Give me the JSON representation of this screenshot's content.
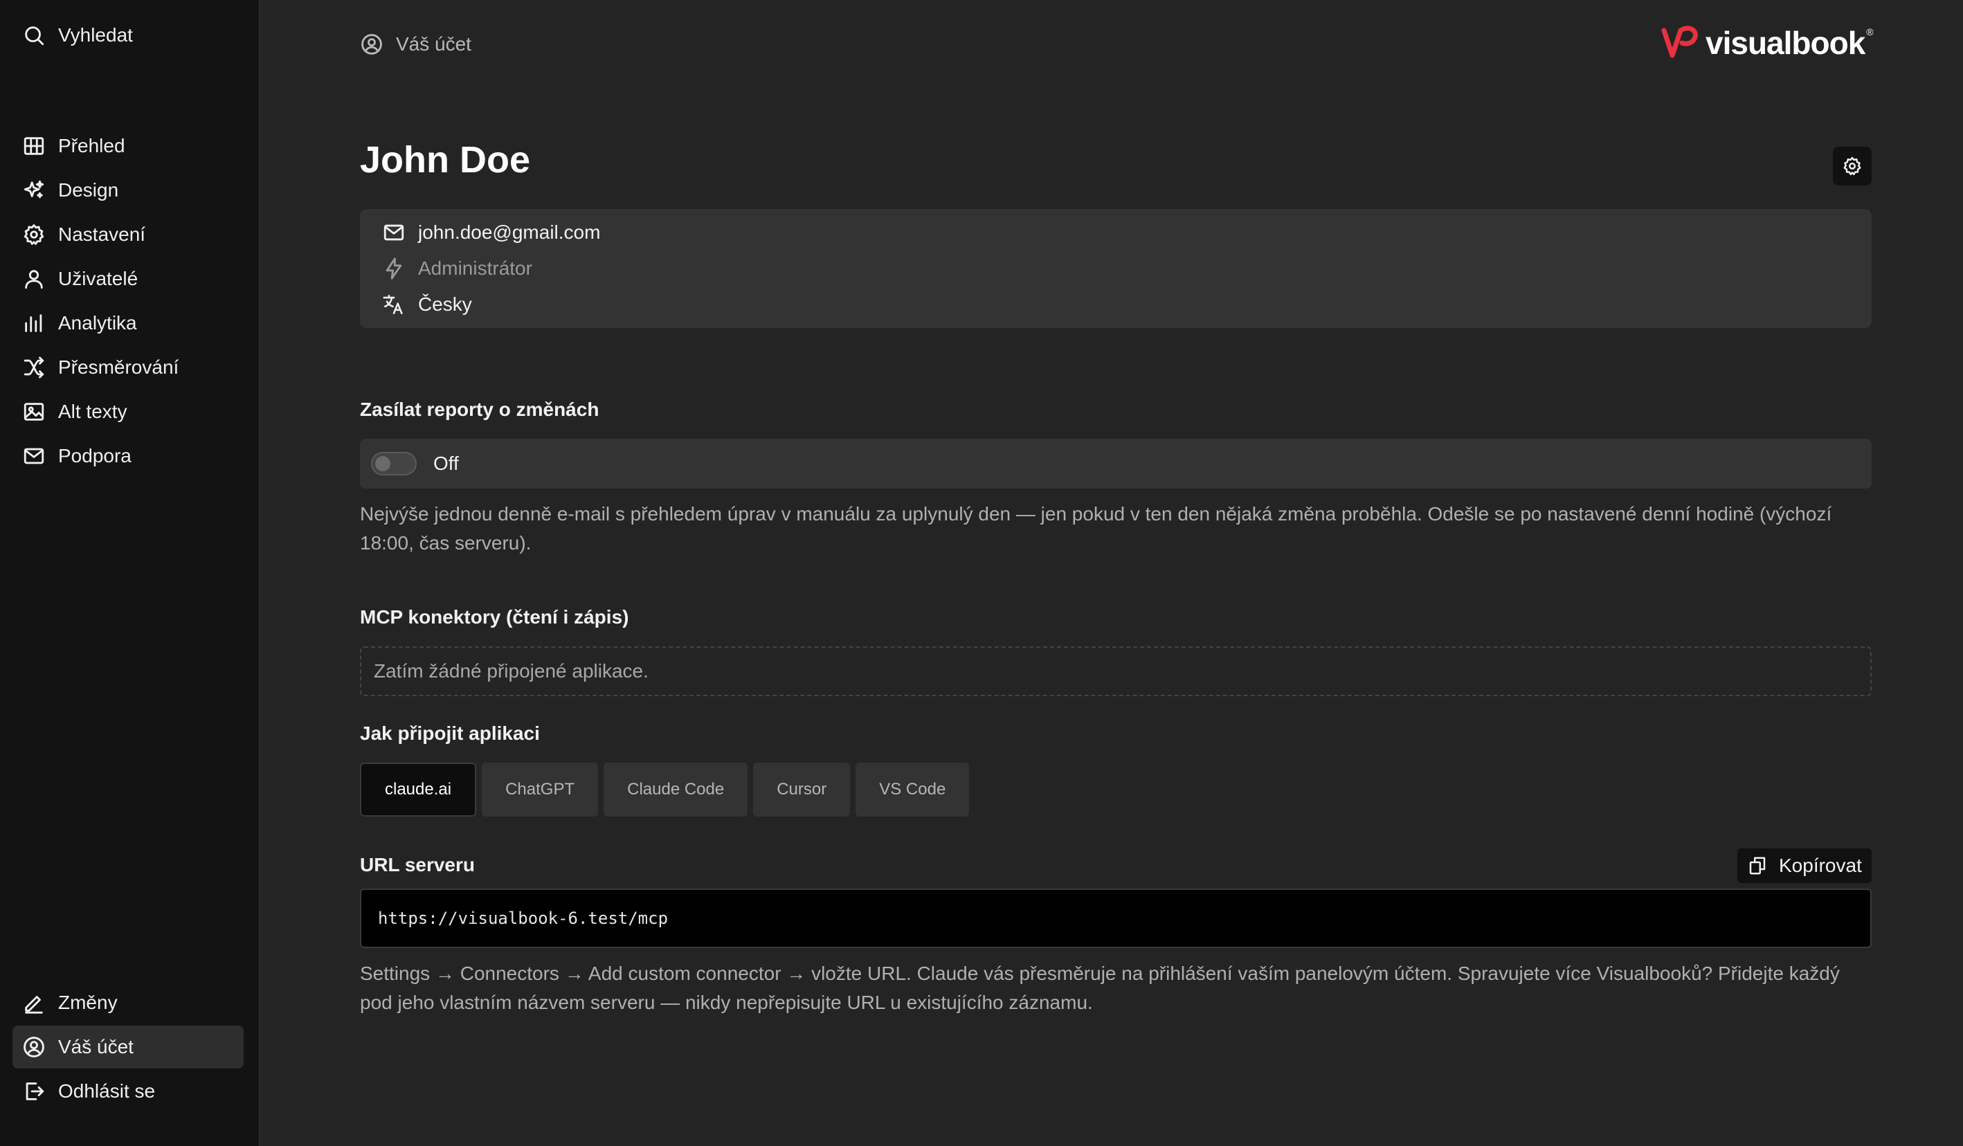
{
  "sidebar": {
    "search": {
      "label": "Vyhledat",
      "icon": "search-icon"
    },
    "items": [
      {
        "label": "Přehled",
        "icon": "grid-icon"
      },
      {
        "label": "Design",
        "icon": "sparkles-icon"
      },
      {
        "label": "Nastavení",
        "icon": "gear-icon"
      },
      {
        "label": "Uživatelé",
        "icon": "user-icon"
      },
      {
        "label": "Analytika",
        "icon": "bar-chart-icon"
      },
      {
        "label": "Přesměrování",
        "icon": "shuffle-icon"
      },
      {
        "label": "Alt texty",
        "icon": "image-icon"
      },
      {
        "label": "Podpora",
        "icon": "mail-icon"
      }
    ],
    "bottom": [
      {
        "label": "Změny",
        "icon": "pencil-icon"
      },
      {
        "label": "Váš účet",
        "icon": "account-circle-icon",
        "active": true
      },
      {
        "label": "Odhlásit se",
        "icon": "logout-icon"
      }
    ]
  },
  "header": {
    "breadcrumb": "Váš účet",
    "logo_text": "visualbook",
    "logo_reg": "®",
    "brand_color": "#e8313f"
  },
  "profile": {
    "name": "John Doe",
    "email": "john.doe@gmail.com",
    "role": "Administrátor",
    "language": "Česky"
  },
  "reports": {
    "title": "Zasílat reporty o změnách",
    "toggle_state": "Off",
    "help": "Nejvýše jednou denně e-mail s přehledem úprav v manuálu za uplynulý den — jen pokud v ten den nějaká změna proběhla. Odešle se po nastavené denní hodině (výchozí 18:00, čas serveru)."
  },
  "mcp": {
    "title": "MCP konektory (čtení i zápis)",
    "empty": "Zatím žádné připojené aplikace.",
    "connect_title": "Jak připojit aplikaci",
    "tabs": [
      "claude.ai",
      "ChatGPT",
      "Claude Code",
      "Cursor",
      "VS Code"
    ],
    "active_tab": "claude.ai",
    "url_label": "URL serveru",
    "copy_label": "Kopírovat",
    "url": "https://visualbook-6.test/mcp",
    "instructions": "Settings → Connectors → Add custom connector → vložte URL. Claude vás přesměruje na přihlášení vaším panelovým účtem. Spravujete více Visualbooků? Přidejte každý pod jeho vlastním názvem serveru — nikdy nepřepisujte URL u existujícího záznamu."
  }
}
